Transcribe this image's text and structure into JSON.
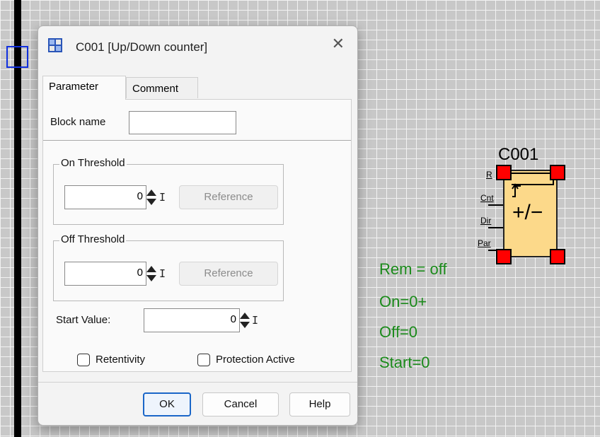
{
  "dialog": {
    "title": "C001 [Up/Down counter]",
    "close": "✕",
    "tabs": [
      {
        "label": "Parameter",
        "active": true
      },
      {
        "label": "Comment",
        "active": false
      }
    ],
    "block_name": {
      "label": "Block name",
      "value": ""
    },
    "on_threshold": {
      "title": "On Threshold",
      "value": "0",
      "unit": "I",
      "reference": "Reference"
    },
    "off_threshold": {
      "title": "Off Threshold",
      "value": "0",
      "unit": "I",
      "reference": "Reference"
    },
    "start_value": {
      "label": "Start Value:",
      "value": "0",
      "unit": "I"
    },
    "retentivity": {
      "label": "Retentivity",
      "checked": false
    },
    "protection": {
      "label": "Protection Active",
      "checked": false
    },
    "buttons": {
      "ok": "OK",
      "cancel": "Cancel",
      "help": "Help"
    }
  },
  "block": {
    "name": "C001",
    "symbol": "+/−",
    "pins": [
      "R",
      "Cnt",
      "Dir",
      "Par"
    ],
    "params": [
      "Rem = off",
      "On=0+",
      "Off=0",
      "Start=0"
    ],
    "param_color": "#1a8a1a",
    "body_color": "#fcd98a",
    "handle_color": "#ff0000"
  },
  "canvas": {
    "selection_color": "#1030e0"
  }
}
